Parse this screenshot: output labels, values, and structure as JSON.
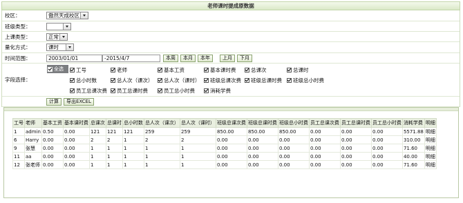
{
  "title": "老师课时提成原数据",
  "form": {
    "school": {
      "label": "校区：",
      "value": "傲然天成校区"
    },
    "class_type": {
      "label": "班级类型：",
      "value": ""
    },
    "lesson_type": {
      "label": "上课类型：",
      "value": "正常"
    },
    "quant": {
      "label": "量化方式：",
      "value": "课时"
    },
    "time": {
      "label": "时间范围：",
      "from": "2003/01/01",
      "to": "-2015/4/7",
      "buttons": [
        "本周",
        "本月",
        "本年",
        "上月",
        "下月"
      ]
    },
    "fields": {
      "label": "字段选择：",
      "select_all": "全选",
      "items": [
        "工号",
        "老师",
        "基本工资",
        "基本课时费",
        "总课次",
        "总课时",
        "总小时数",
        "总人次（课次）",
        "总人次（课时）",
        "班级总课次费",
        "班级总课时费",
        "班级总小时费",
        "员工总课次费",
        "员工总课时费",
        "员工总小时费",
        "消耗学费"
      ]
    },
    "actions": {
      "calc": "计算",
      "export": "导出EXCEL"
    }
  },
  "table": {
    "headers": [
      "工号",
      "老师",
      "基本工资",
      "基本课时费",
      "总课次",
      "总课时",
      "总小时数",
      "总人次（课次）",
      "总人次（课时）",
      "班级总课次费",
      "班级总课时费",
      "班级总小时费",
      "员工总课次费",
      "员工总课时费",
      "员工总小时费",
      "消耗学费",
      "明细"
    ],
    "rows": [
      [
        "1",
        "admin",
        "0.50",
        "0.00",
        "121",
        "121",
        "121",
        "259",
        "259",
        "850.00",
        "850.00",
        "850.00",
        "0.00",
        "0.00",
        "0.00",
        "5571.88",
        "明细"
      ],
      [
        "6",
        "Harry",
        "0.00",
        "0.00",
        "2",
        "2",
        "1",
        "2",
        "2",
        "0.00",
        "0.00",
        "0.00",
        "0.00",
        "0.00",
        "0.00",
        "310.00",
        "明细"
      ],
      [
        "9",
        "张慧",
        "0.00",
        "0.00",
        "1",
        "1",
        "1",
        "1",
        "1",
        "0.00",
        "0.00",
        "0.00",
        "0.00",
        "0.00",
        "0.00",
        "71.60",
        "明细"
      ],
      [
        "11",
        "aa",
        "0.00",
        "0.00",
        "1",
        "1",
        "1",
        "1",
        "1",
        "0.00",
        "0.00",
        "0.00",
        "0.00",
        "0.00",
        "0.00",
        "40.00",
        "明细"
      ],
      [
        "12",
        "张老师",
        "0.00",
        "0.00",
        "1",
        "1",
        "1",
        "1",
        "1",
        "0.00",
        "0.00",
        "0.00",
        "0.00",
        "0.00",
        "0.00",
        "71.60",
        "明细"
      ]
    ]
  }
}
